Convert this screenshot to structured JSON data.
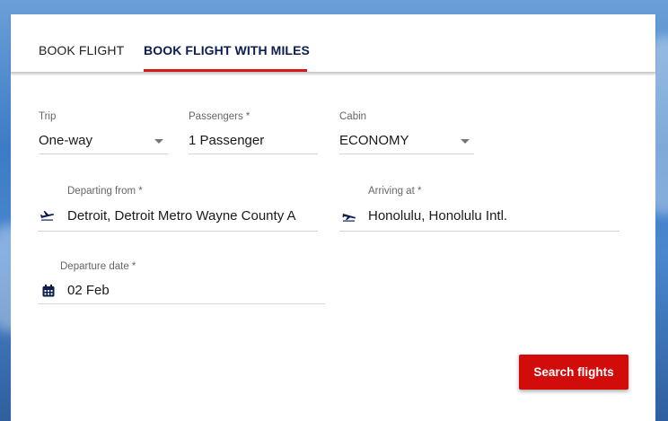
{
  "tabs": [
    {
      "label": "BOOK FLIGHT",
      "active": false
    },
    {
      "label": "BOOK FLIGHT WITH MILES",
      "active": true
    }
  ],
  "trip": {
    "label": "Trip",
    "value": "One-way"
  },
  "passengers": {
    "label": "Passengers *",
    "value": "1 Passenger"
  },
  "cabin": {
    "label": "Cabin",
    "value": "ECONOMY"
  },
  "departing": {
    "label": "Departing from *",
    "value": "Detroit, Detroit Metro Wayne County A"
  },
  "arriving": {
    "label": "Arriving at *",
    "value": "Honolulu, Honolulu Intl."
  },
  "departure_date": {
    "label": "Departure date *",
    "value": "02 Feb"
  },
  "search_button": {
    "label": "Search flights"
  },
  "colors": {
    "accent": "#d20b0b",
    "tab_active": "#0b1e4f"
  },
  "icons": [
    "plane-takeoff-icon",
    "plane-landing-icon",
    "calendar-icon",
    "chevron-down-icon"
  ]
}
